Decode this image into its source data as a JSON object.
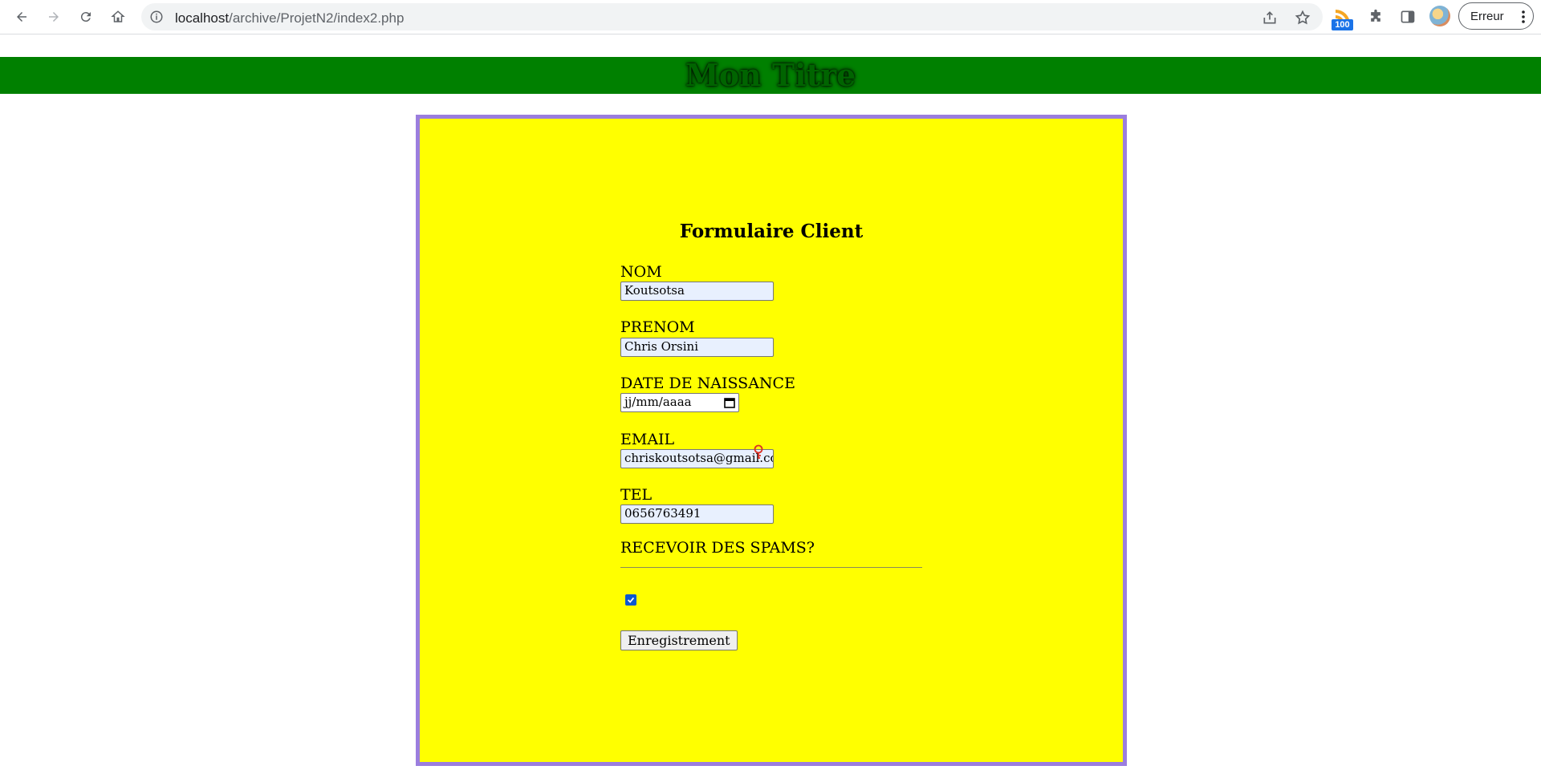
{
  "browser": {
    "url_host": "localhost",
    "url_path": "/archive/ProjetN2/index2.php",
    "rss_badge": "100",
    "profile_label": "Erreur"
  },
  "header": {
    "title": "Mon Titre",
    "background": "#008000"
  },
  "form": {
    "title": "Formulaire Client",
    "panel_background": "#ffff00",
    "panel_border": "#9b7ede",
    "fields": {
      "nom": {
        "label": "NOM",
        "value": "Koutsotsa"
      },
      "prenom": {
        "label": "PRENOM",
        "value": "Chris Orsini"
      },
      "date": {
        "label": "DATE DE NAISSANCE",
        "placeholder": "jj/mm/aaaa"
      },
      "email": {
        "label": "EMAIL",
        "value": "chriskoutsotsa@gmail.com"
      },
      "tel": {
        "label": "TEL",
        "value": "0656763491"
      }
    },
    "spam": {
      "label": "RECEVOIR DES SPAMS?",
      "checked": true
    },
    "submit_label": "Enregistrement"
  }
}
